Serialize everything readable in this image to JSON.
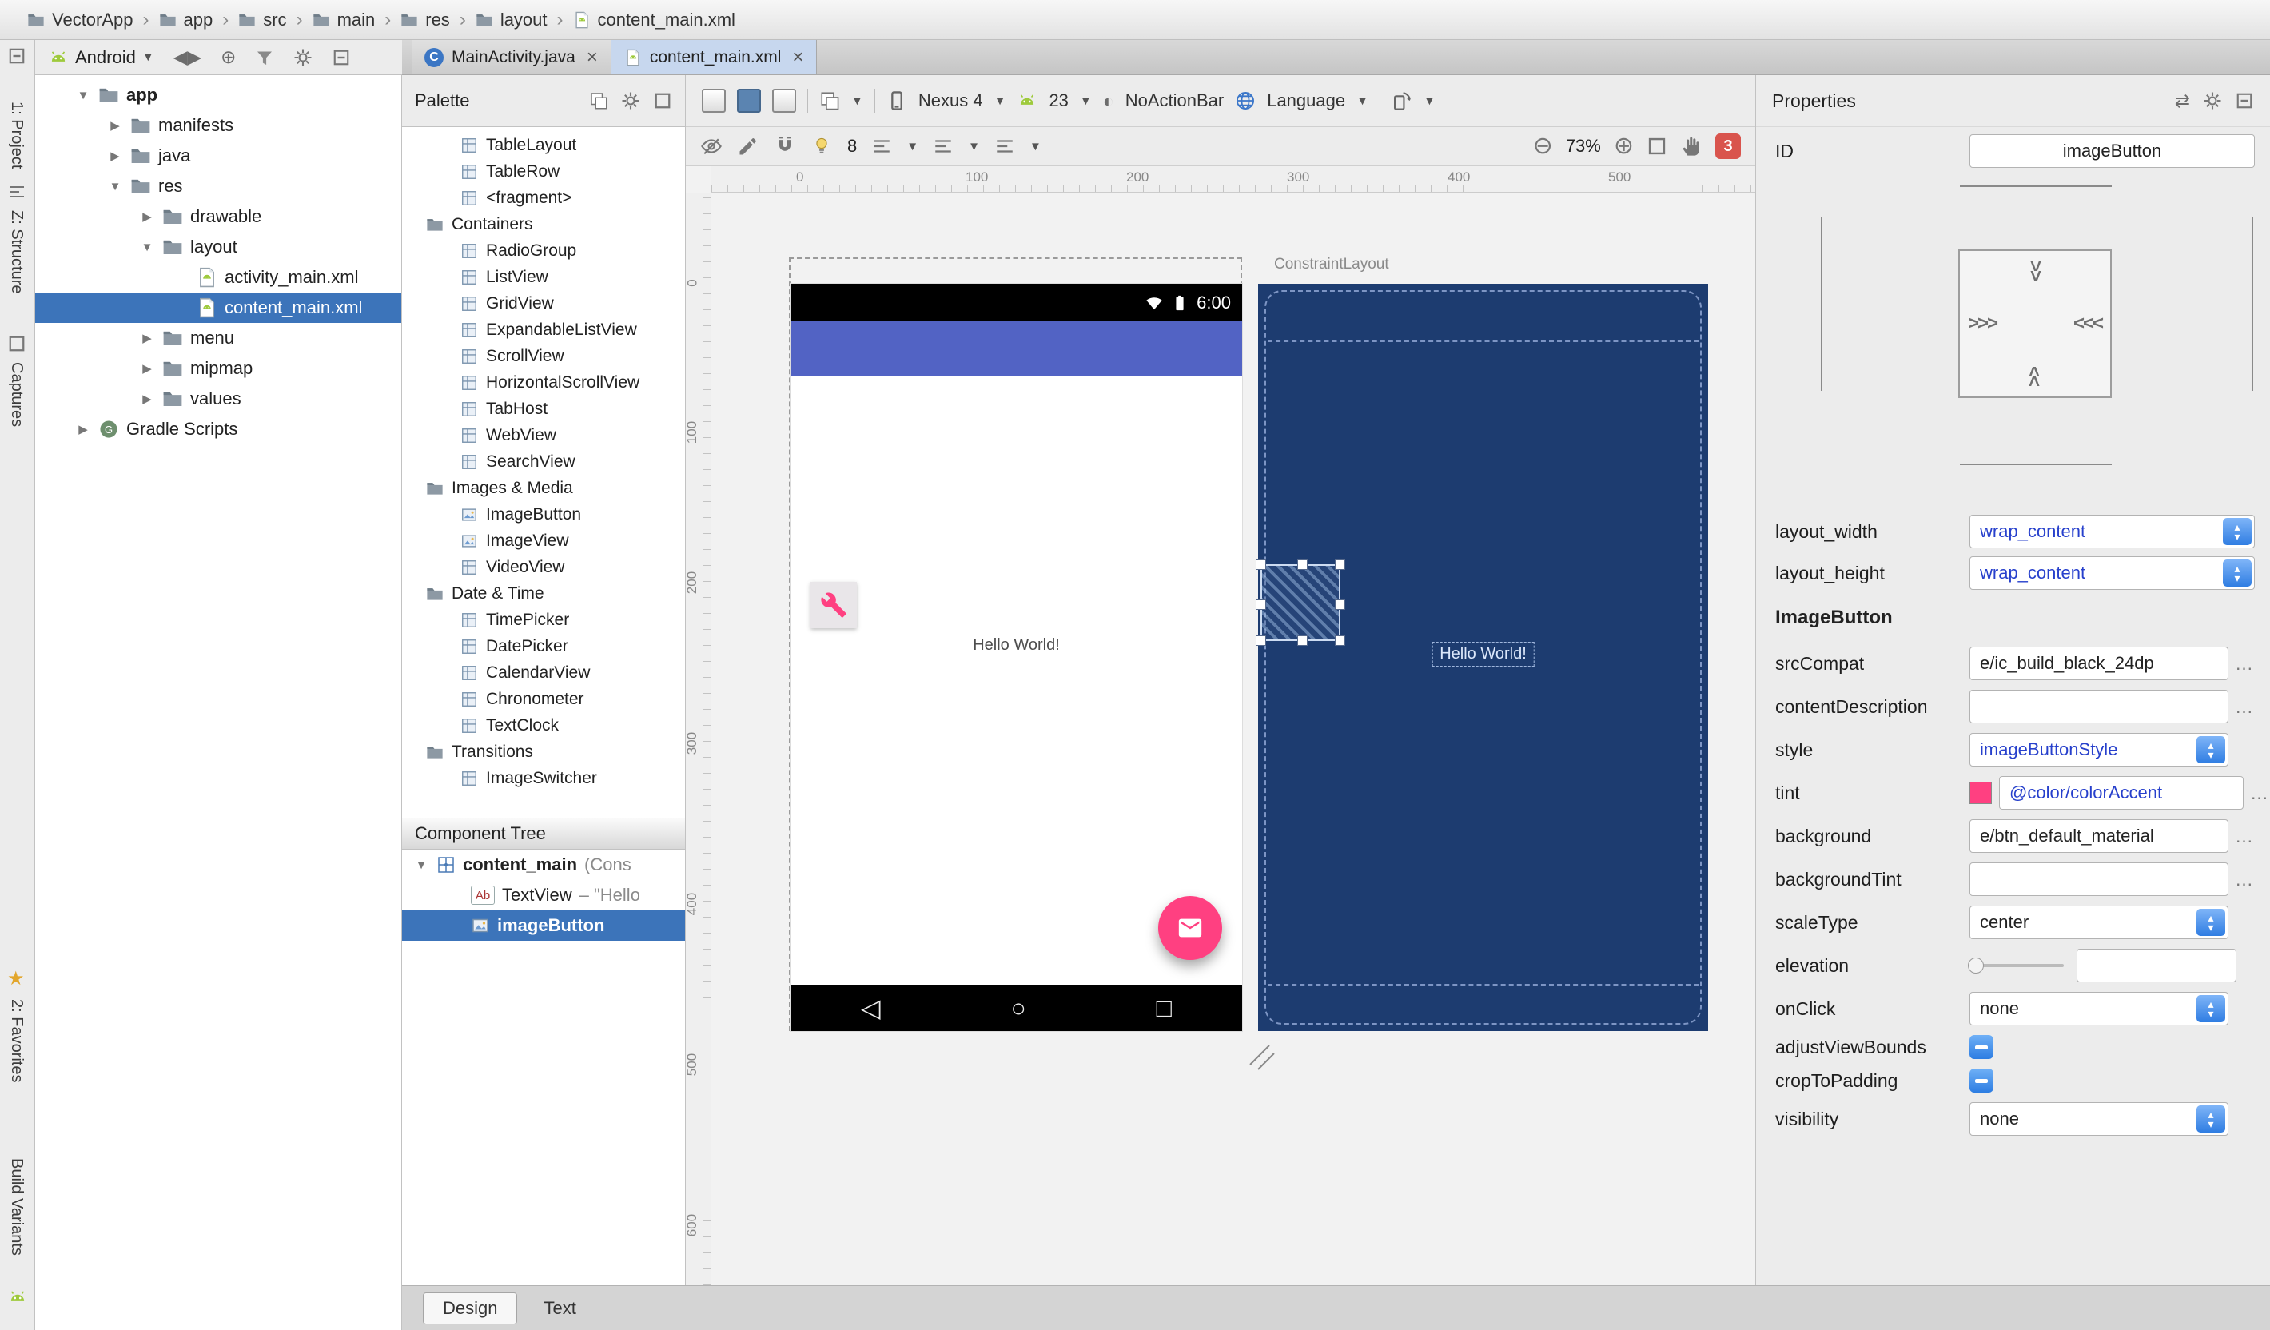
{
  "breadcrumbs": {
    "items": [
      "VectorApp",
      "app",
      "src",
      "main",
      "res",
      "layout",
      "content_main.xml"
    ]
  },
  "tool_strip": {
    "top": [
      "1: Project",
      "Z: Structure",
      "Captures"
    ],
    "bottom": [
      "2: Favorites",
      "Build Variants"
    ]
  },
  "project_panel": {
    "view_selector": "Android",
    "tree": [
      {
        "label": "app"
      },
      {
        "label": "manifests"
      },
      {
        "label": "java"
      },
      {
        "label": "res"
      },
      {
        "label": "drawable"
      },
      {
        "label": "layout"
      },
      {
        "label": "activity_main.xml"
      },
      {
        "label": "content_main.xml"
      },
      {
        "label": "menu"
      },
      {
        "label": "mipmap"
      },
      {
        "label": "values"
      },
      {
        "label": "Gradle Scripts"
      }
    ]
  },
  "editor_tabs": {
    "tabs": [
      {
        "label": "MainActivity.java"
      },
      {
        "label": "content_main.xml"
      }
    ],
    "close_glyph": "×"
  },
  "palette": {
    "title": "Palette",
    "items": [
      {
        "label": "TableLayout"
      },
      {
        "label": "TableRow"
      },
      {
        "label": "<fragment>"
      },
      {
        "label": "Containers"
      },
      {
        "label": "RadioGroup"
      },
      {
        "label": "ListView"
      },
      {
        "label": "GridView"
      },
      {
        "label": "ExpandableListView"
      },
      {
        "label": "ScrollView"
      },
      {
        "label": "HorizontalScrollView"
      },
      {
        "label": "TabHost"
      },
      {
        "label": "WebView"
      },
      {
        "label": "SearchView"
      },
      {
        "label": "Images & Media"
      },
      {
        "label": "ImageButton"
      },
      {
        "label": "ImageView"
      },
      {
        "label": "VideoView"
      },
      {
        "label": "Date & Time"
      },
      {
        "label": "TimePicker"
      },
      {
        "label": "DatePicker"
      },
      {
        "label": "CalendarView"
      },
      {
        "label": "Chronometer"
      },
      {
        "label": "TextClock"
      },
      {
        "label": "Transitions"
      },
      {
        "label": "ImageSwitcher"
      }
    ]
  },
  "component_tree": {
    "title": "Component Tree",
    "items": [
      {
        "label": "content_main",
        "suffix": " (Cons"
      },
      {
        "label": "TextView",
        "suffix": " – \"Hello"
      },
      {
        "label": "imageButton",
        "suffix": ""
      }
    ]
  },
  "design_toolbar": {
    "device": "Nexus 4",
    "api_level": "23",
    "theme": "NoActionBar",
    "locale": "Language",
    "snap_value": "8",
    "zoom_level": "73%",
    "error_count": "3"
  },
  "rulers": {
    "horizontal": [
      "0",
      "100",
      "200",
      "300",
      "400",
      "500"
    ],
    "vertical": [
      "0",
      "100",
      "200",
      "300",
      "400",
      "500",
      "600"
    ]
  },
  "design_preview": {
    "status_time": "6:00",
    "hello_text": "Hello World!"
  },
  "blueprint": {
    "root_label": "ConstraintLayout",
    "hello_text": "Hello World!"
  },
  "properties": {
    "title": "Properties",
    "id_label": "ID",
    "id_value": "imageButton",
    "section_title": "ImageButton",
    "more_glyph": "…",
    "rows": {
      "layout_width": {
        "label": "layout_width",
        "value": "wrap_content"
      },
      "layout_height": {
        "label": "layout_height",
        "value": "wrap_content"
      },
      "srcCompat": {
        "label": "srcCompat",
        "value": "e/ic_build_black_24dp"
      },
      "contentDescription": {
        "label": "contentDescription",
        "value": ""
      },
      "style": {
        "label": "style",
        "value": "imageButtonStyle"
      },
      "tint": {
        "label": "tint",
        "value": "@color/colorAccent",
        "swatch": "#FF4081"
      },
      "background": {
        "label": "background",
        "value": "e/btn_default_material"
      },
      "backgroundTint": {
        "label": "backgroundTint",
        "value": ""
      },
      "scaleType": {
        "label": "scaleType",
        "value": "center"
      },
      "elevation": {
        "label": "elevation",
        "value": ""
      },
      "onClick": {
        "label": "onClick",
        "value": "none"
      },
      "adjustViewBounds": {
        "label": "adjustViewBounds"
      },
      "cropToPadding": {
        "label": "cropToPadding"
      },
      "visibility": {
        "label": "visibility",
        "value": "none"
      }
    }
  },
  "bottom_tabs": {
    "design": "Design",
    "text": "Text"
  },
  "colors": {
    "accent_pink": "#FF4081",
    "appbar_blue": "#5263C4",
    "blueprint_navy": "#1D3C70",
    "selection_blue": "#3C74BA",
    "android_green": "#9ECA3C",
    "error_red": "#D9544D"
  }
}
